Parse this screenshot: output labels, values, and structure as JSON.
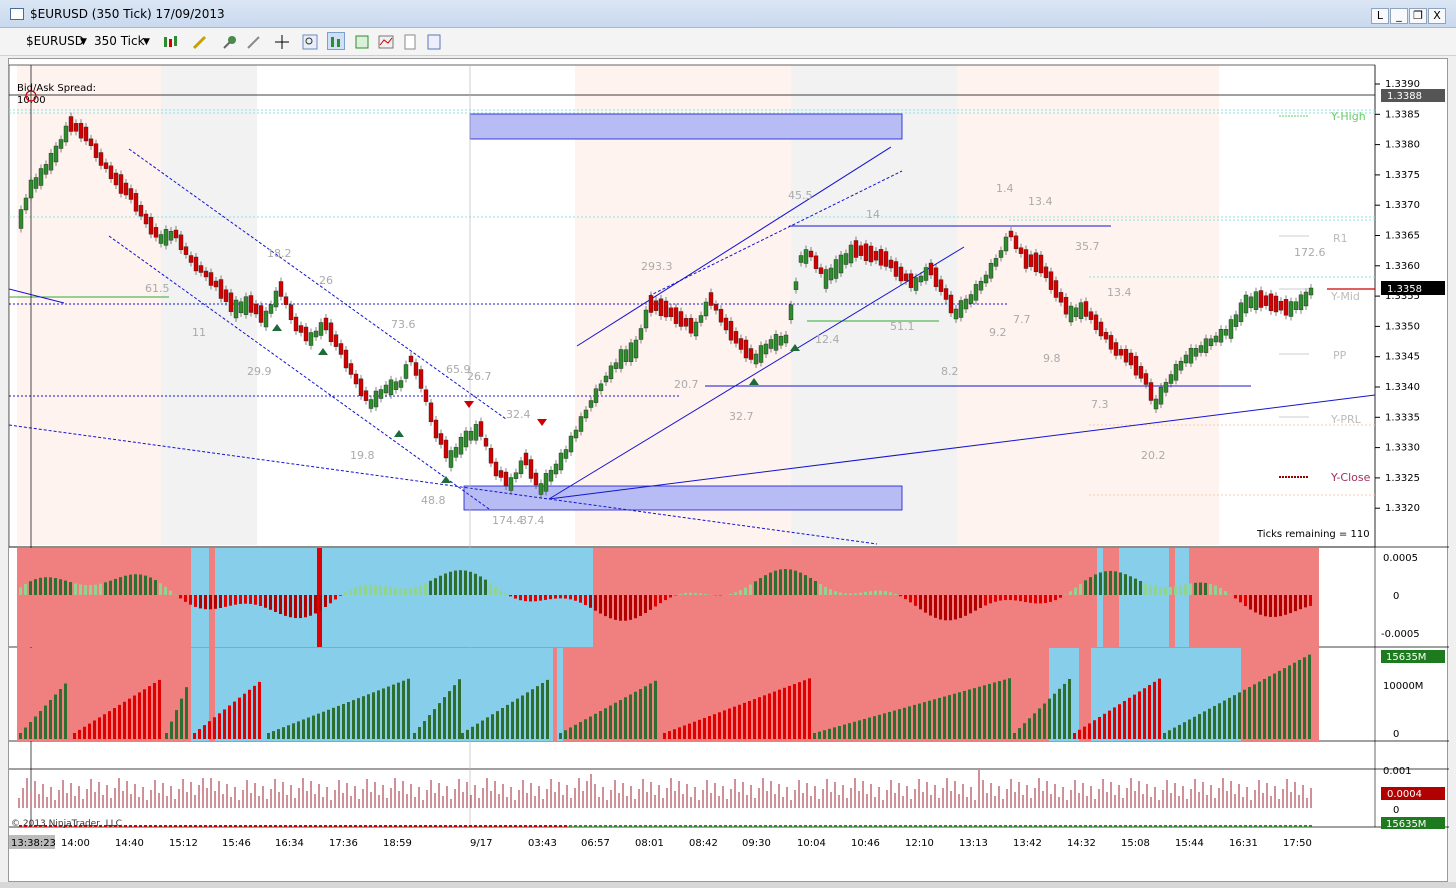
{
  "window": {
    "title": "$EURUSD (350 Tick)  17/09/2013",
    "btn_link": "L",
    "btn_min": "_",
    "btn_max": "❐",
    "btn_close": "X"
  },
  "toolbar": {
    "instrument": "$EURUSD",
    "interval": "350 Tick"
  },
  "price_axis": {
    "labels": [
      "1.3390",
      "1.3385",
      "1.3380",
      "1.3375",
      "1.3370",
      "1.3365",
      "1.3360",
      "1.3355",
      "1.3350",
      "1.3345",
      "1.3340",
      "1.3335",
      "1.3330",
      "1.3325",
      "1.3320"
    ],
    "ask_marker": "1.3388",
    "last_marker": "1.3358"
  },
  "overlay_text": {
    "spread_label": "Bid/Ask Spread:",
    "spread_value": "10.00",
    "ticks_remaining": "Ticks remaining = 110",
    "copyright": "© 2013 NinjaTrader, LLC"
  },
  "pivots": {
    "y_high": "Y-High",
    "r1": "R1",
    "y_mid": "Y-Mid",
    "pp": "PP",
    "y_prl": "Y-PRL",
    "y_close": "Y-Close"
  },
  "panel2_axis": [
    "0.0005",
    "0",
    "-0.0005"
  ],
  "panel3_axis": {
    "marker": "15635M",
    "mid": "10000M",
    "zero": "0"
  },
  "panel4_axis": {
    "top": "0.001",
    "marker": "0.0004",
    "zero": "0",
    "bottom_marker": "15635M"
  },
  "time_axis": [
    "13:38:23",
    "14:00",
    "14:40",
    "15:12",
    "15:46",
    "16:34",
    "17:36",
    "18:59",
    "9/17",
    "03:43",
    "06:57",
    "08:01",
    "08:42",
    "09:30",
    "10:04",
    "10:46",
    "12:10",
    "13:13",
    "13:42",
    "14:32",
    "15:08",
    "15:44",
    "16:31",
    "17:50"
  ],
  "swing_labels": [
    "61.5",
    "11",
    "29.9",
    "73.6",
    "19.8",
    "48.8",
    "174.4",
    "37.4",
    "32.4",
    "293.3",
    "20.7",
    "32.7",
    "12.4",
    "51.1",
    "9.2",
    "8.2",
    "7.7",
    "9.8",
    "13.4",
    "7.3",
    "35.7",
    "20.2",
    "172.6",
    "45.5",
    "14",
    "1.4",
    "13.4",
    "26",
    "65.9",
    "26.7",
    "18.2"
  ],
  "colors": {
    "bull": "#2e8b2e",
    "bear": "#d40000",
    "channel": "#1414d0",
    "zone": "#b0b4f4",
    "panel_red": "#f08080",
    "panel_blue": "#87ceeb"
  }
}
